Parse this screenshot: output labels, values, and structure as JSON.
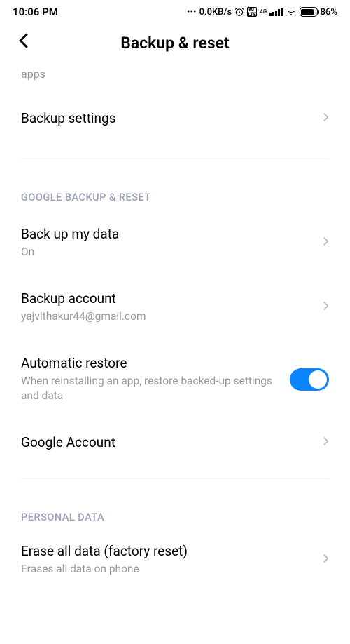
{
  "statusBar": {
    "time": "10:06 PM",
    "dataSpeed": "0.0KB/s",
    "batteryPct": "86%",
    "netType": "4G"
  },
  "header": {
    "title": "Backup & reset"
  },
  "truncatedRow": {
    "visibleText": "apps"
  },
  "settings": {
    "backupSettings": {
      "title": "Backup settings"
    }
  },
  "sections": {
    "googleBackup": {
      "header": "GOOGLE BACKUP & RESET",
      "backupMyData": {
        "title": "Back up my data",
        "subtitle": "On"
      },
      "backupAccount": {
        "title": "Backup account",
        "subtitle": "yajvithakur44@gmail.com"
      },
      "automaticRestore": {
        "title": "Automatic restore",
        "subtitle": "When reinstalling an app, restore backed-up settings and data",
        "enabled": true
      },
      "googleAccount": {
        "title": "Google Account"
      }
    },
    "personalData": {
      "header": "PERSONAL DATA",
      "eraseAllData": {
        "title": "Erase all data (factory reset)",
        "subtitle": "Erases all data on phone"
      }
    }
  }
}
